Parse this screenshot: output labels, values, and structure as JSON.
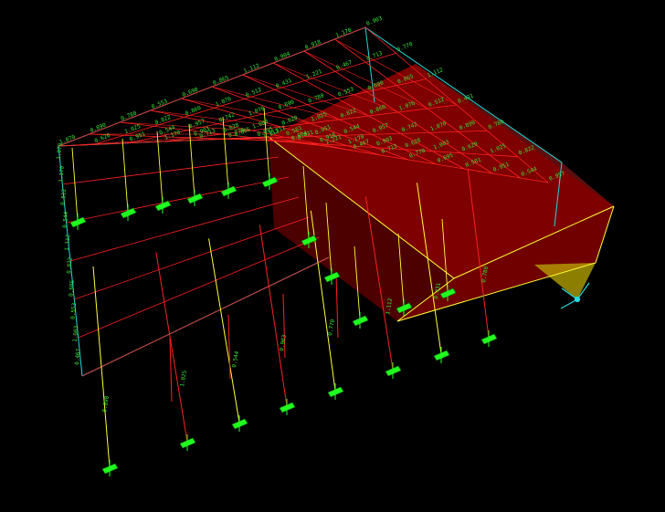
{
  "viewport": {
    "background": "#000000"
  },
  "colors": {
    "frame_edge": "#22dddd",
    "member": "#ff2020",
    "column": "#ffff33",
    "label": "#39e639",
    "support": "#20ff20",
    "panel_fill": "#cc0000",
    "wedge_fill": "#bbaa00",
    "axis": "#22dddd"
  },
  "member_labels": [
    "1.070",
    "0.620",
    "0.951",
    "1.170",
    "0.713",
    "0.865",
    "0.512",
    "0.890",
    "1.025",
    "0.544",
    "0.903",
    "0.770",
    "1.112",
    "0.431",
    "0.780",
    "0.822",
    "0.957",
    "0.628",
    "0.695",
    "0.904",
    "1.221",
    "0.553",
    "0.860",
    "0.742",
    "1.003",
    "0.581",
    "0.918",
    "0.467",
    "0.690",
    "1.076"
  ],
  "axis_indicator": {
    "icon": "xyz-axis-triad"
  }
}
